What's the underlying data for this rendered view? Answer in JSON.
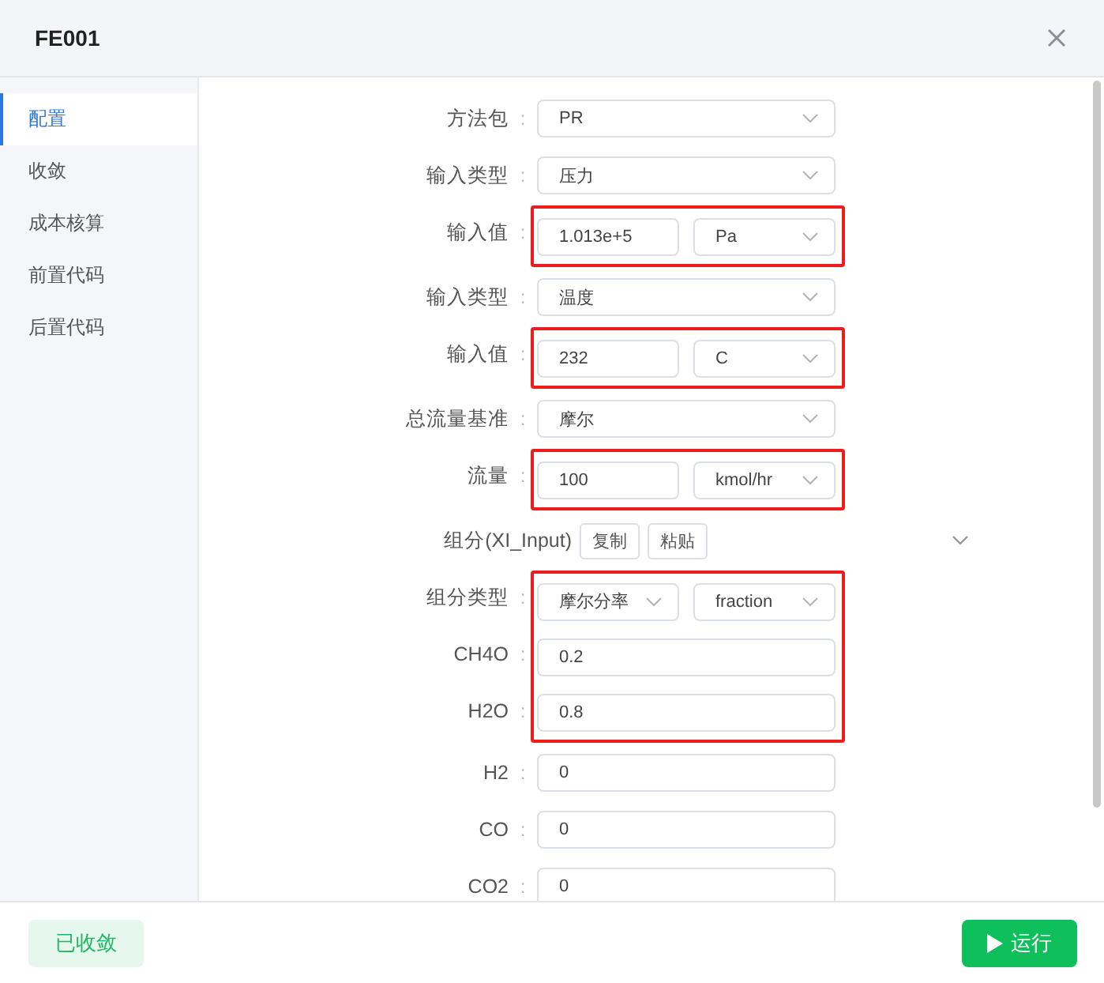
{
  "dialog": {
    "title": "FE001"
  },
  "sidebar": {
    "items": [
      {
        "label": "配置",
        "selected": true
      },
      {
        "label": "收敛",
        "selected": false
      },
      {
        "label": "成本核算",
        "selected": false
      },
      {
        "label": "前置代码",
        "selected": false
      },
      {
        "label": "后置代码",
        "selected": false
      }
    ]
  },
  "form": {
    "rows": [
      {
        "kind": "select",
        "label": "方法包",
        "colon": ":",
        "value": "PR",
        "highlighted": false
      },
      {
        "kind": "select",
        "label": "输入类型",
        "colon": ":",
        "value": "压力",
        "highlighted": false
      },
      {
        "kind": "input_unit",
        "label": "输入值",
        "colon": ":",
        "value": "1.013e+5",
        "unit": "Pa",
        "highlighted": true
      },
      {
        "kind": "select",
        "label": "输入类型",
        "colon": ":",
        "value": "温度",
        "highlighted": false
      },
      {
        "kind": "input_unit",
        "label": "输入值",
        "colon": ":",
        "value": "232",
        "unit": "C",
        "highlighted": true
      },
      {
        "kind": "select",
        "label": "总流量基准",
        "colon": ":",
        "value": "摩尔",
        "highlighted": false
      },
      {
        "kind": "input_unit",
        "label": "流量",
        "colon": ":",
        "value": "100",
        "unit": "kmol/hr",
        "highlighted": true
      },
      {
        "kind": "section",
        "label": "组分(XI_Input)",
        "buttons": [
          "复制",
          "粘贴"
        ]
      },
      {
        "kind": "two_selects",
        "label": "组分类型",
        "colon": ":",
        "value": "摩尔分率",
        "unit": "fraction",
        "highlighted": true
      },
      {
        "kind": "input",
        "label": "CH4O",
        "colon": ":",
        "value": "0.2",
        "highlighted": true
      },
      {
        "kind": "input",
        "label": "H2O",
        "colon": ":",
        "value": "0.8",
        "highlighted": true
      },
      {
        "kind": "input",
        "label": "H2",
        "colon": ":",
        "value": "0",
        "highlighted": false
      },
      {
        "kind": "input",
        "label": "CO",
        "colon": ":",
        "value": "0",
        "highlighted": false
      },
      {
        "kind": "input",
        "label": "CO2",
        "colon": ":",
        "value": "0",
        "highlighted": false
      }
    ]
  },
  "footer": {
    "status": "已收敛",
    "run_button": "运行"
  }
}
